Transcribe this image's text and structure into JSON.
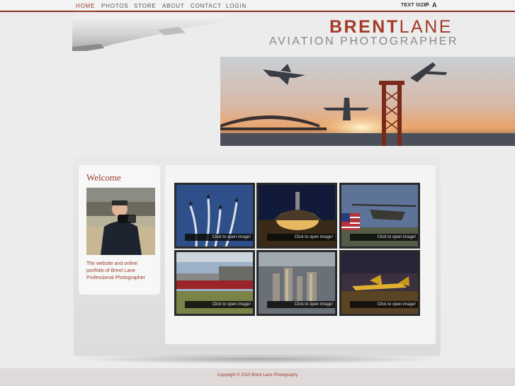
{
  "nav": {
    "items": [
      {
        "label": "HOME",
        "active": true
      },
      {
        "label": "PHOTOS",
        "active": false
      },
      {
        "label": "STORE",
        "active": false
      },
      {
        "label": "ABOUT",
        "active": false
      },
      {
        "label": "CONTACT",
        "active": false
      },
      {
        "label": "LOGIN",
        "active": false
      }
    ],
    "text_size_label": "TEXT SIZE",
    "text_size_small": "A",
    "text_size_large": "A"
  },
  "header": {
    "logo_part1": "BRENT",
    "logo_part2": "LANE",
    "tagline": "AVIATION PHOTOGRAPHER"
  },
  "welcome": {
    "title": "Welcome",
    "text": "The website and online portfolio of Brent Lane Professional Photographer"
  },
  "gallery": {
    "thumbnails": [
      {
        "caption": "Click to open image!",
        "subject": "aerobatic-jets"
      },
      {
        "caption": "Click to open image!",
        "subject": "night-hangar"
      },
      {
        "caption": "Click to open image!",
        "subject": "apache-helicopter"
      },
      {
        "caption": "Click to open image!",
        "subject": "train"
      },
      {
        "caption": "Click to open image!",
        "subject": "city-aerial"
      },
      {
        "caption": "Click to open image!",
        "subject": "jet-sunset"
      }
    ]
  },
  "footer": {
    "copyright": "Copyright © 2010 Brent Lane Photography"
  },
  "colors": {
    "accent": "#9a3b2b",
    "nav_border": "#8a2d22",
    "background": "#ececec"
  }
}
